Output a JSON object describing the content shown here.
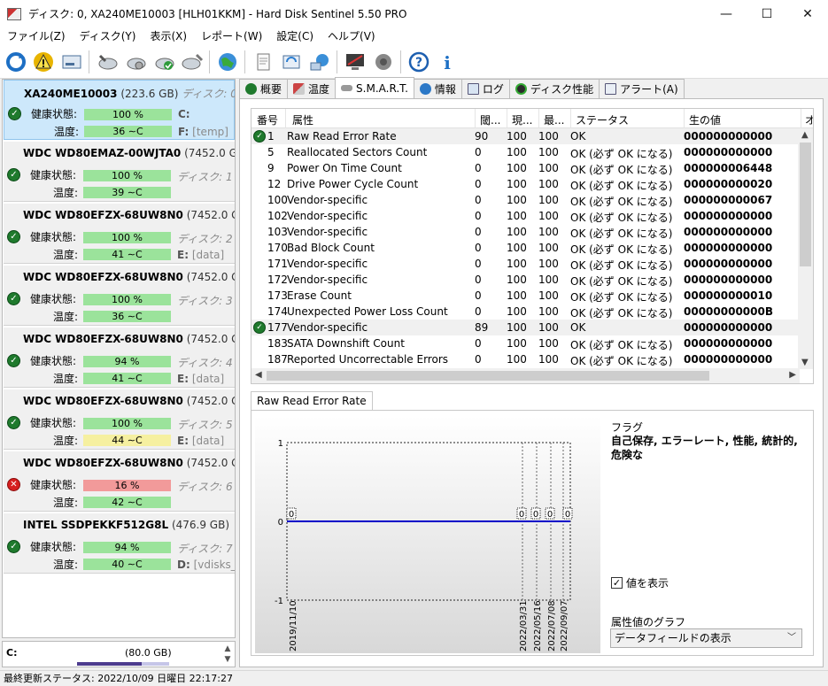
{
  "window": {
    "title": "ディスク: 0, XA240ME10003 [HLH01KKM]  -  Hard Disk Sentinel 5.50 PRO",
    "minimize": "—",
    "maximize": "☐",
    "close": "✕"
  },
  "menu": [
    "ファイル(Z)",
    "ディスク(Y)",
    "表示(X)",
    "レポート(W)",
    "設定(C)",
    "ヘルプ(V)"
  ],
  "disks": [
    {
      "name": "XA240ME10003",
      "size": "(223.6 GB)",
      "index": "ディスク: 0",
      "health_label": "健康状態:",
      "health": "100 %",
      "health_color": "green",
      "temp_label": "温度:",
      "temp": "36 ∼C",
      "temp_color": "green",
      "extra": "C:",
      "path_drive": "F:",
      "path": "[temp]",
      "status": "ok"
    },
    {
      "name": "WDC WD80EMAZ-00WJTA0",
      "size": "(7452.0 GB)",
      "index": "",
      "health_label": "健康状態:",
      "health": "100 %",
      "health_color": "green",
      "temp_label": "温度:",
      "temp": "39 ∼C",
      "temp_color": "green",
      "extra": "ディスク: 1",
      "path_drive": "",
      "path": "",
      "status": "ok"
    },
    {
      "name": "WDC WD80EFZX-68UW8N0",
      "size": "(7452.0 GB)",
      "index": "",
      "health_label": "健康状態:",
      "health": "100 %",
      "health_color": "green",
      "temp_label": "温度:",
      "temp": "41 ∼C",
      "temp_color": "green",
      "extra": "ディスク: 2",
      "path_drive": "E:",
      "path": "[data]",
      "status": "ok"
    },
    {
      "name": "WDC WD80EFZX-68UW8N0",
      "size": "(7452.0 GB)",
      "index": "",
      "health_label": "健康状態:",
      "health": "100 %",
      "health_color": "green",
      "temp_label": "温度:",
      "temp": "36 ∼C",
      "temp_color": "green",
      "extra": "ディスク: 3",
      "path_drive": "",
      "path": "",
      "status": "ok"
    },
    {
      "name": "WDC WD80EFZX-68UW8N0",
      "size": "(7452.0 GB)",
      "index": "",
      "health_label": "健康状態:",
      "health": "94 %",
      "health_color": "green",
      "temp_label": "温度:",
      "temp": "41 ∼C",
      "temp_color": "green",
      "extra": "ディスク: 4",
      "path_drive": "E:",
      "path": "[data]",
      "status": "ok"
    },
    {
      "name": "WDC WD80EFZX-68UW8N0",
      "size": "(7452.0 GB)",
      "index": "",
      "health_label": "健康状態:",
      "health": "100 %",
      "health_color": "green",
      "temp_label": "温度:",
      "temp": "44 ∼C",
      "temp_color": "yellow",
      "extra": "ディスク: 5",
      "path_drive": "E:",
      "path": "[data]",
      "status": "ok"
    },
    {
      "name": "WDC WD80EFZX-68UW8N0",
      "size": "(7452.0 GB)",
      "index": "",
      "health_label": "健康状態:",
      "health": "16 %",
      "health_color": "red",
      "temp_label": "温度:",
      "temp": "42 ∼C",
      "temp_color": "green",
      "extra": "ディスク: 6",
      "path_drive": "",
      "path": "",
      "status": "error"
    },
    {
      "name": "INTEL SSDPEKKF512G8L",
      "size": "(476.9 GB)",
      "index": "",
      "health_label": "健康状態:",
      "health": "94 %",
      "health_color": "green",
      "temp_label": "温度:",
      "temp": "40 ∼C",
      "temp_color": "green",
      "extra": "ディスク: 7",
      "path_drive": "D:",
      "path": "[vdisks_sy",
      "status": "ok"
    }
  ],
  "volume": {
    "label": "C:",
    "size": "(80.0 GB)"
  },
  "statusbar": "最終更新ステータス: 2022/10/09 日曜日 22:17:27",
  "tabs": [
    "概要",
    "温度",
    "S.M.A.R.T.",
    "情報",
    "ログ",
    "ディスク性能",
    "アラート(A)"
  ],
  "active_tab": 2,
  "smart": {
    "columns": [
      "番号",
      "属性",
      "閾...",
      "現...",
      "最...",
      "ステータス",
      "生の値",
      "オ"
    ],
    "rows": [
      {
        "id": "1",
        "name": "Raw Read Error Rate",
        "thr": "90",
        "cur": "100",
        "worst": "100",
        "status": "OK",
        "raw": "000000000000",
        "icon": true,
        "hl": true
      },
      {
        "id": "5",
        "name": "Reallocated Sectors Count",
        "thr": "0",
        "cur": "100",
        "worst": "100",
        "status": "OK (必ず OK になる)",
        "raw": "000000000000",
        "icon": false,
        "hl": false
      },
      {
        "id": "9",
        "name": "Power On Time Count",
        "thr": "0",
        "cur": "100",
        "worst": "100",
        "status": "OK (必ず OK になる)",
        "raw": "000000006448",
        "icon": false,
        "hl": false
      },
      {
        "id": "12",
        "name": "Drive Power Cycle Count",
        "thr": "0",
        "cur": "100",
        "worst": "100",
        "status": "OK (必ず OK になる)",
        "raw": "000000000020",
        "icon": false,
        "hl": false
      },
      {
        "id": "100",
        "name": "Vendor-specific",
        "thr": "0",
        "cur": "100",
        "worst": "100",
        "status": "OK (必ず OK になる)",
        "raw": "000000000067",
        "icon": false,
        "hl": false
      },
      {
        "id": "102",
        "name": "Vendor-specific",
        "thr": "0",
        "cur": "100",
        "worst": "100",
        "status": "OK (必ず OK になる)",
        "raw": "000000000000",
        "icon": false,
        "hl": false
      },
      {
        "id": "103",
        "name": "Vendor-specific",
        "thr": "0",
        "cur": "100",
        "worst": "100",
        "status": "OK (必ず OK になる)",
        "raw": "000000000000",
        "icon": false,
        "hl": false
      },
      {
        "id": "170",
        "name": "Bad Block Count",
        "thr": "0",
        "cur": "100",
        "worst": "100",
        "status": "OK (必ず OK になる)",
        "raw": "000000000000",
        "icon": false,
        "hl": false
      },
      {
        "id": "171",
        "name": "Vendor-specific",
        "thr": "0",
        "cur": "100",
        "worst": "100",
        "status": "OK (必ず OK になる)",
        "raw": "000000000000",
        "icon": false,
        "hl": false
      },
      {
        "id": "172",
        "name": "Vendor-specific",
        "thr": "0",
        "cur": "100",
        "worst": "100",
        "status": "OK (必ず OK になる)",
        "raw": "000000000000",
        "icon": false,
        "hl": false
      },
      {
        "id": "173",
        "name": "Erase Count",
        "thr": "0",
        "cur": "100",
        "worst": "100",
        "status": "OK (必ず OK になる)",
        "raw": "000000000010",
        "icon": false,
        "hl": false
      },
      {
        "id": "174",
        "name": "Unexpected Power Loss Count",
        "thr": "0",
        "cur": "100",
        "worst": "100",
        "status": "OK (必ず OK になる)",
        "raw": "00000000000B",
        "icon": false,
        "hl": false
      },
      {
        "id": "177",
        "name": "Vendor-specific",
        "thr": "89",
        "cur": "100",
        "worst": "100",
        "status": "OK",
        "raw": "000000000000",
        "icon": true,
        "hl": true
      },
      {
        "id": "183",
        "name": "SATA Downshift Count",
        "thr": "0",
        "cur": "100",
        "worst": "100",
        "status": "OK (必ず OK になる)",
        "raw": "000000000000",
        "icon": false,
        "hl": false
      },
      {
        "id": "187",
        "name": "Reported Uncorrectable Errors",
        "thr": "0",
        "cur": "100",
        "worst": "100",
        "status": "OK (必ず OK になる)",
        "raw": "000000000000",
        "icon": false,
        "hl": false
      }
    ]
  },
  "chart": {
    "tab": "Raw Read Error Rate",
    "y_ticks": [
      "1",
      "0",
      "-1"
    ],
    "x_dates": [
      "2019/11/10",
      "2022/03/31",
      "2022/05/16",
      "2022/07/08",
      "2022/09/07"
    ],
    "value_labels": [
      "0",
      "0",
      "0",
      "0",
      "0"
    ],
    "line_color": "#0000c8"
  },
  "flag": {
    "title": "フラグ",
    "text": "自己保存, エラーレート, 性能, 統計的, 危険な"
  },
  "show_values": {
    "label": "値を表示",
    "checked": "✓"
  },
  "graph_select": {
    "label": "属性値のグラフ",
    "value": "データフィールドの表示"
  }
}
